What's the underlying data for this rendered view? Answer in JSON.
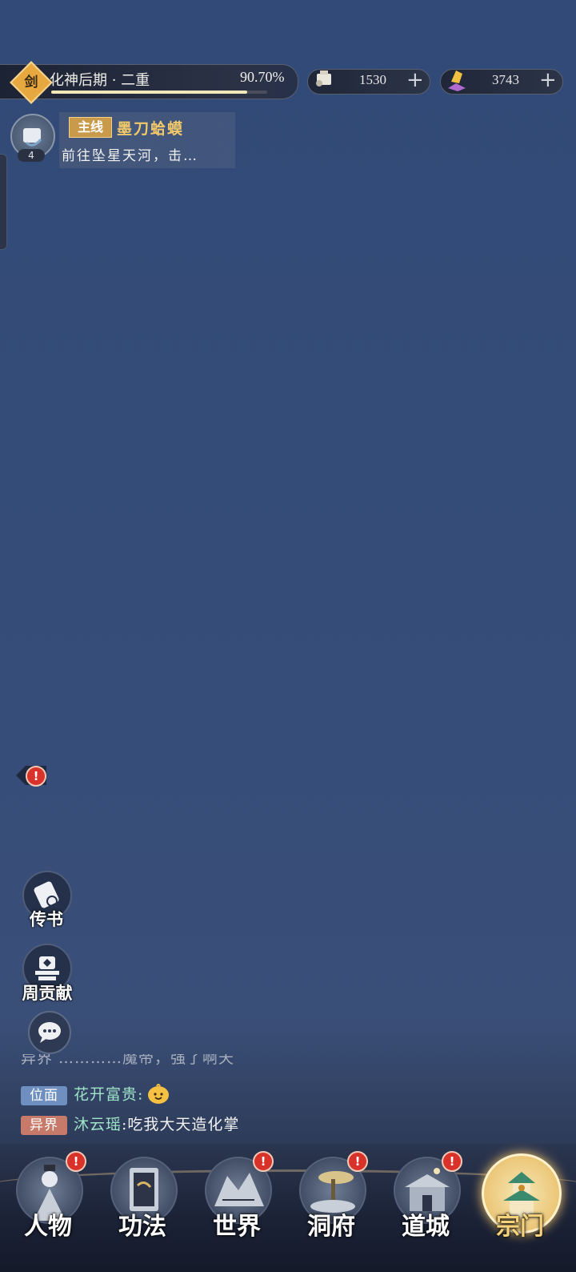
{
  "top_bar": {
    "realm_badge": "剑",
    "realm_name": "化神后期 · 二重",
    "progress_percent_text": "90.70%",
    "progress_fraction": 0.907
  },
  "currencies": [
    {
      "icon": "scroll-currency-icon",
      "value": "1530",
      "plus": "+"
    },
    {
      "icon": "gold-ingot-currency-icon",
      "value": "3743",
      "plus": "+"
    }
  ],
  "quest": {
    "count": "4",
    "tag": "主线",
    "title": "墨刀蛤蟆",
    "description": "前往坠星天河，击…"
  },
  "side_buttons": {
    "notif_mark": "!",
    "letter_label": "传书",
    "weekly_label": "周贡献"
  },
  "chat": {
    "partial": "异界  …………魔帝，强了啊天",
    "lines": [
      {
        "tag": "位面",
        "tag_color": "#6e8fbf",
        "name": "花开富贵",
        "sep": ":",
        "message": ""
      },
      {
        "tag": "异界",
        "tag_color": "#c77a6a",
        "name": "沐云瑶",
        "sep": ":",
        "message": "吃我大天造化掌"
      }
    ]
  },
  "nav": {
    "items": [
      {
        "label": "人物",
        "badge": "!"
      },
      {
        "label": "功法",
        "badge": ""
      },
      {
        "label": "世界",
        "badge": "!"
      },
      {
        "label": "洞府",
        "badge": "!"
      },
      {
        "label": "道城",
        "badge": "!"
      },
      {
        "label": "宗门",
        "badge": "",
        "active": true
      }
    ]
  },
  "colors": {
    "background": "#364d79",
    "accent_gold": "#f2c96a",
    "badge_red": "#d8322a"
  }
}
